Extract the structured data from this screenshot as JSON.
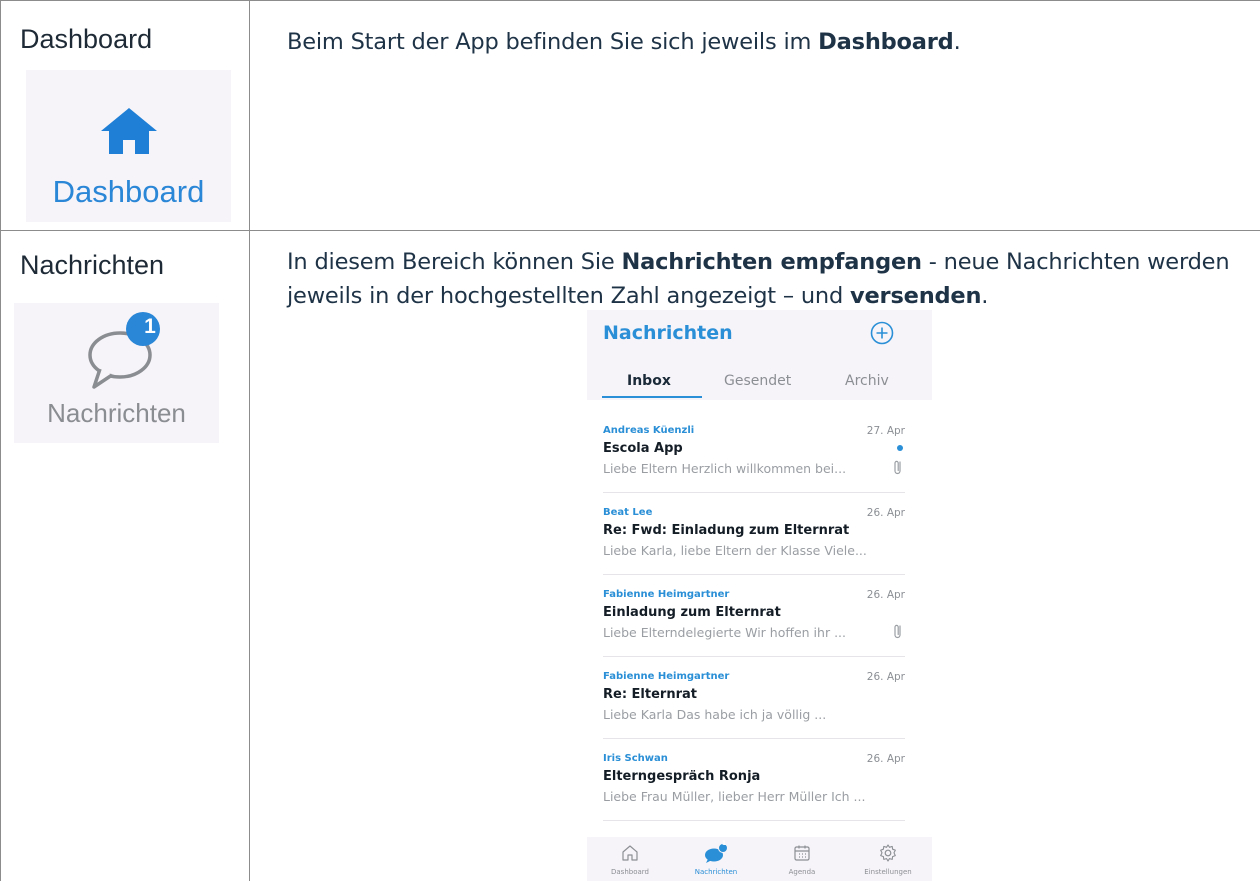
{
  "rows": [
    {
      "title": "Dashboard",
      "text_parts": [
        "Beim Start der App befinden Sie sich jeweils im ",
        "Dashboard",
        "."
      ],
      "icon_label": "Dashboard",
      "icon_name": "home-icon"
    },
    {
      "title": "Nachrichten",
      "line1_parts": [
        "In diesem Bereich können Sie ",
        "Nachrichten empfangen",
        " - neue Nachrichten werden"
      ],
      "line2_parts": [
        "jeweils in der hochgestellten Zahl angezeigt – und ",
        "versenden",
        "."
      ],
      "icon_label": "Nachrichten",
      "icon_name": "chat-bubble-icon",
      "badge": "1"
    }
  ],
  "phone": {
    "title": "Nachrichten",
    "tabs": [
      "Inbox",
      "Gesendet",
      "Archiv"
    ],
    "messages": [
      {
        "sender": "Andreas Küenzli",
        "date": "27. Apr",
        "subject": "Escola App",
        "preview": "Liebe Eltern  Herzlich willkommen bei...",
        "unread": true,
        "attachment": true
      },
      {
        "sender": "Beat Lee",
        "date": "26. Apr",
        "subject": "Re: Fwd: Einladung zum Elternrat",
        "preview": "Liebe Karla, liebe Eltern der Klasse  Viele...",
        "unread": false,
        "attachment": false
      },
      {
        "sender": "Fabienne Heimgartner",
        "date": "26. Apr",
        "subject": "Einladung zum Elternrat",
        "preview": "Liebe Elterndelegierte  Wir hoffen ihr ...",
        "unread": false,
        "attachment": true
      },
      {
        "sender": "Fabienne Heimgartner",
        "date": "26. Apr",
        "subject": "Re: Elternrat",
        "preview": "Liebe Karla  Das habe ich ja völlig ...",
        "unread": false,
        "attachment": false
      },
      {
        "sender": "Iris Schwan",
        "date": "26. Apr",
        "subject": "Elterngespräch Ronja",
        "preview": "Liebe Frau Müller, lieber Herr Müller  Ich ...",
        "unread": false,
        "attachment": false
      }
    ],
    "bottom_nav": [
      "Dashboard",
      "Nachrichten",
      "Agenda",
      "Einstellungen"
    ],
    "bottom_badge": "1",
    "accent_color": "#2a8fd6"
  }
}
